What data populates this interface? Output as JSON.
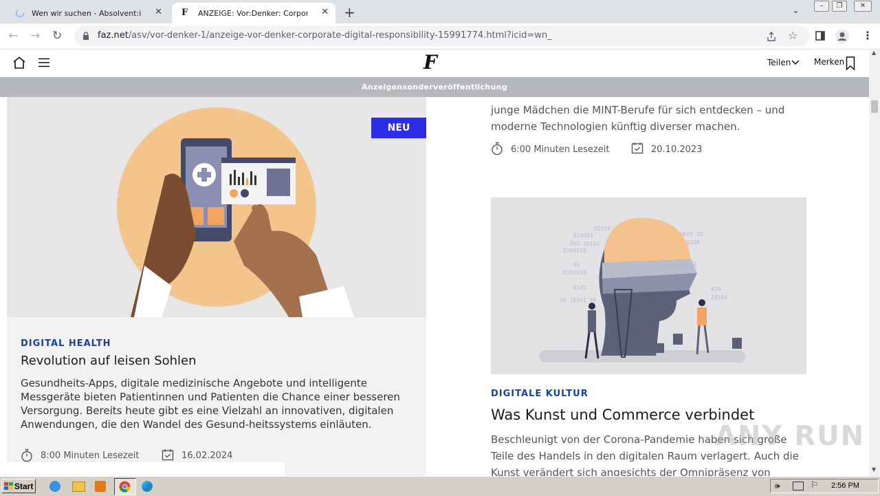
{
  "browser": {
    "tabs": [
      {
        "title": "Wen wir suchen - Absolvent:innen | ",
        "active": false
      },
      {
        "title": "ANZEIGE: Vor:Denker: Corporate Di",
        "active": true
      }
    ],
    "url_host": "faz.net",
    "url_path": "/asv/vor-denker-1/anzeige-vor-denker-corporate-digital-responsibility-15991774.html?icid=wn_"
  },
  "site": {
    "logo": "F",
    "share_label": "Teilen",
    "bookmark_label": "Merken",
    "ad_banner": "Anzeigensonderveröffentlichung"
  },
  "left_article": {
    "badge": "NEU",
    "kicker": "DIGITAL HEALTH",
    "headline": "Revolution auf leisen Sohlen",
    "teaser_lines": [
      "Gesundheits-Apps, digitale medizinische Angebote und intelligente",
      "Messgeräte bieten Patientinnen und Patienten die Chance einer besseren",
      "Versorgung. Bereits heute gibt es eine Vielzahl an innovativen, digitalen",
      "Anwendungen, die den Wandel des Gesund-heitssystems einläuten."
    ],
    "read_time": "8:00 Minuten Lesezeit",
    "date": "16.02.2024"
  },
  "right_top": {
    "teaser_lines": [
      "junge Mädchen die MINT-Berufe für sich entdecken – und",
      "moderne Technologien künftig diverser machen."
    ],
    "read_time": "6:00 Minuten Lesezeit",
    "date": "20.10.2023"
  },
  "right_article": {
    "kicker": "DIGITALE KULTUR",
    "headline": "Was Kunst und Commerce verbindet",
    "teaser_lines": [
      "Beschleunigt von der Corona-Pandemie haben sich große",
      "Teile des Handels in den digitalen Raum verlagert. Auch die",
      "Kunst verändert sich angesichts der Omnipräsenz von"
    ]
  },
  "taskbar": {
    "start_label": "Start",
    "clock": "2:56 PM"
  },
  "watermark": "ANY RUN",
  "colors": {
    "accent_blue": "#1741a9",
    "badge_bg": "#2d2de6",
    "banner_bg": "#b6b9bb",
    "card_bg": "#f2f2f2"
  }
}
